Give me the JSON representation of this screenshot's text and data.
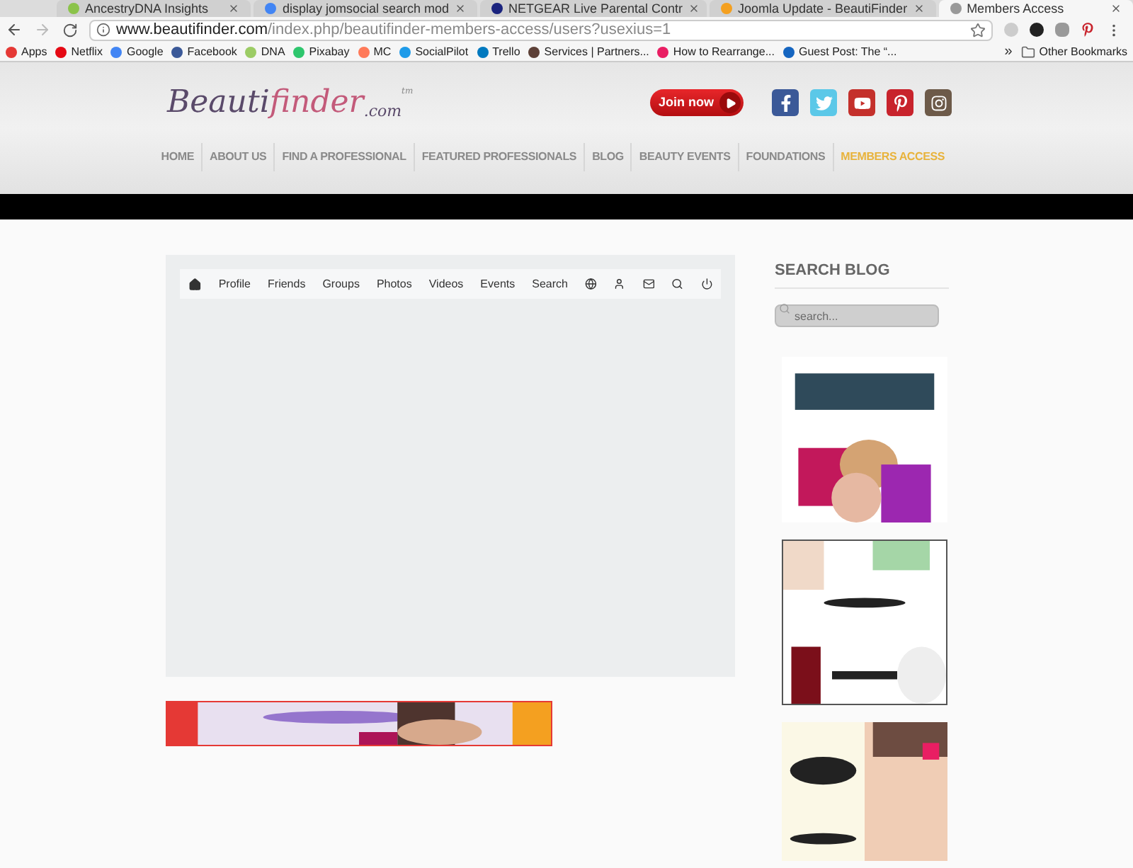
{
  "browser": {
    "tabs": [
      {
        "title": "AncestryDNA Insights",
        "selected": false,
        "color": "#8bc34a"
      },
      {
        "title": "display jomsocial search mod",
        "selected": false,
        "color": "#4285f4"
      },
      {
        "title": "NETGEAR Live Parental Contr",
        "selected": false,
        "color": "#1a237e"
      },
      {
        "title": "Joomla Update - BeautiFinder",
        "selected": false,
        "color": "#f4a020"
      },
      {
        "title": "Members Access",
        "selected": true,
        "color": "#999999"
      }
    ],
    "address": {
      "host": "www.beautifinder.com",
      "path": "/index.php/beautifinder-members-access/users?usexius=1"
    },
    "bookmarks": [
      {
        "label": "Apps",
        "color": "#e53935"
      },
      {
        "label": "Netflix",
        "color": "#e50914"
      },
      {
        "label": "Google",
        "color": "#4285f4"
      },
      {
        "label": "Facebook",
        "color": "#3b5998"
      },
      {
        "label": "DNA",
        "color": "#9ccc65"
      },
      {
        "label": "Pixabay",
        "color": "#2ec66d"
      },
      {
        "label": "MC",
        "color": "#ff7a59"
      },
      {
        "label": "SocialPilot",
        "color": "#1e9be9"
      },
      {
        "label": "Trello",
        "color": "#0079bf"
      },
      {
        "label": "Services | Partners...",
        "color": "#5d4037"
      },
      {
        "label": "How to Rearrange...",
        "color": "#e91e63"
      },
      {
        "label": "Guest Post: The “...",
        "color": "#1565c0"
      }
    ],
    "overflow": "»",
    "other_bookmarks": "Other Bookmarks"
  },
  "site": {
    "logo": {
      "main": "Beauti",
      "accent": "finder",
      "suffix": ".com",
      "tm": "tm"
    },
    "join": "Join now",
    "nav": [
      {
        "label": "HOME",
        "selected": false
      },
      {
        "label": "ABOUT US",
        "selected": false
      },
      {
        "label": "FIND A PROFESSIONAL",
        "selected": false
      },
      {
        "label": "FEATURED PROFESSIONALS",
        "selected": false
      },
      {
        "label": "BLOG",
        "selected": false
      },
      {
        "label": "BEAUTY EVENTS",
        "selected": false
      },
      {
        "label": "FOUNDATIONS",
        "selected": false
      },
      {
        "label": "MEMBERS ACCESS",
        "selected": true
      }
    ],
    "toolbar": [
      "Profile",
      "Friends",
      "Groups",
      "Photos",
      "Videos",
      "Events",
      "Search"
    ],
    "sidebar": {
      "title": "SEARCH BLOG",
      "placeholder": "search..."
    }
  }
}
